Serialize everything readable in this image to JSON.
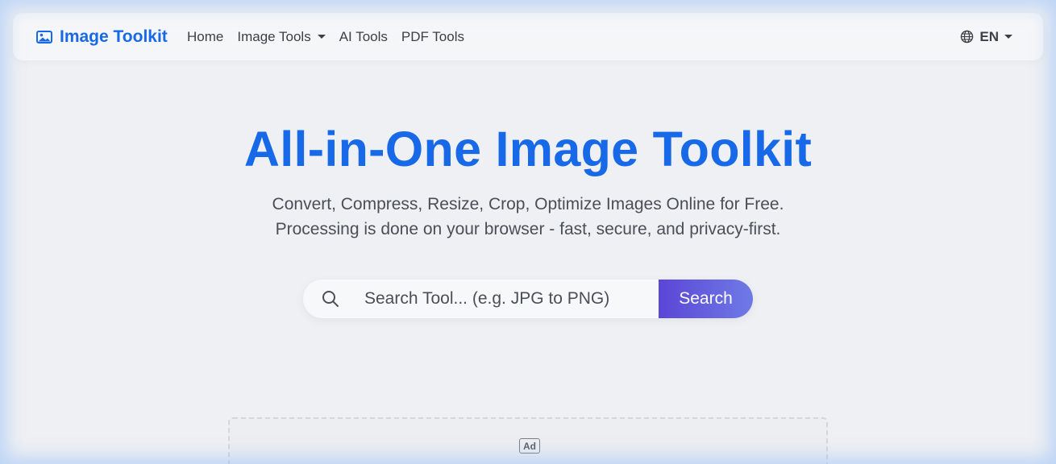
{
  "brand": {
    "name": "Image Toolkit",
    "icon": "image-icon",
    "color": "#1769e8"
  },
  "nav": {
    "items": [
      {
        "label": "Home",
        "has_dropdown": false
      },
      {
        "label": "Image Tools",
        "has_dropdown": true
      },
      {
        "label": "AI Tools",
        "has_dropdown": false
      },
      {
        "label": "PDF Tools",
        "has_dropdown": false
      }
    ],
    "language": {
      "label": "EN",
      "icon": "globe-icon"
    }
  },
  "hero": {
    "title": "All-in-One Image Toolkit",
    "subtitle_line1": "Convert, Compress, Resize, Crop, Optimize Images Online for Free.",
    "subtitle_line2": "Processing is done on your browser - fast, secure, and privacy-first."
  },
  "search": {
    "placeholder": "Search Tool... (e.g. JPG to PNG)",
    "value": "",
    "button_label": "Search",
    "icon": "search-icon",
    "button_colors": [
      "#5b46d6",
      "#6f7ae6"
    ]
  },
  "ad": {
    "label": "Ad"
  }
}
